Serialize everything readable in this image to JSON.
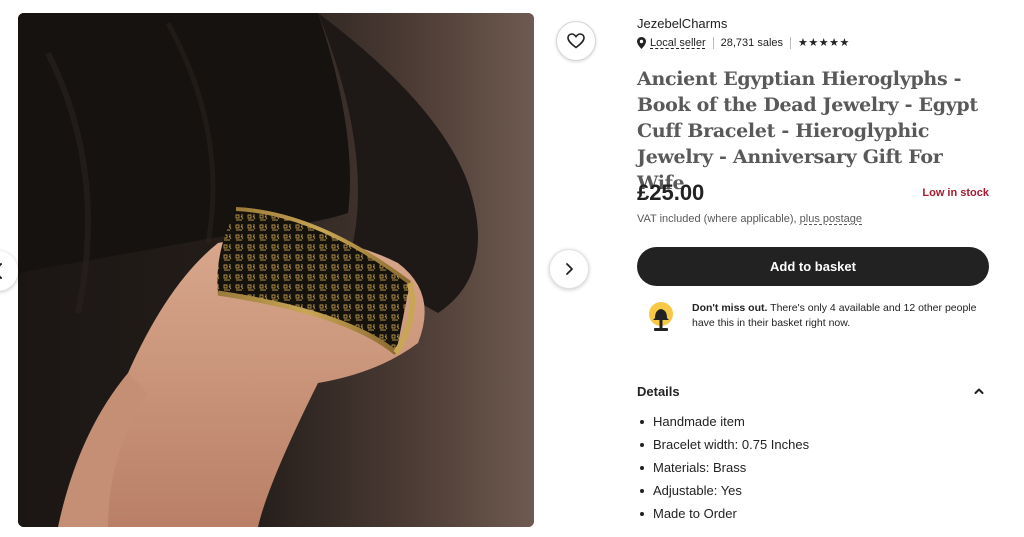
{
  "shop": {
    "name": "JezebelCharms",
    "local_seller": "Local seller",
    "sales": "28,731 sales",
    "stars": "★★★★★"
  },
  "listing": {
    "title": "Ancient Egyptian Hieroglyphs - Book of the Dead Jewelry - Egypt Cuff Bracelet - Hieroglyphic Jewelry - Anniversary Gift For Wife",
    "price": "£25.00",
    "stock_status": "Low in stock",
    "vat_text": "VAT included (where applicable),",
    "postage_link": "plus postage",
    "add_to_basket": "Add to basket"
  },
  "scarcity": {
    "bold": "Don't miss out.",
    "text": "There's only 4 available and 12 other people have this in their basket right now."
  },
  "details": {
    "heading": "Details",
    "items": [
      "Handmade item",
      "Bracelet width: 0.75 Inches",
      "Materials: Brass",
      "Adjustable: Yes",
      "Made to Order"
    ]
  },
  "icons": {
    "favorite": "heart-icon",
    "next": "chevron-right-icon",
    "previous": "chevron-left-icon",
    "location": "map-pin-icon",
    "alert": "bell-icon",
    "collapse": "chevron-up-icon"
  },
  "colors": {
    "button_bg": "#222222",
    "stock_red": "#a61a2e",
    "alert_yellow": "#f7c846"
  }
}
